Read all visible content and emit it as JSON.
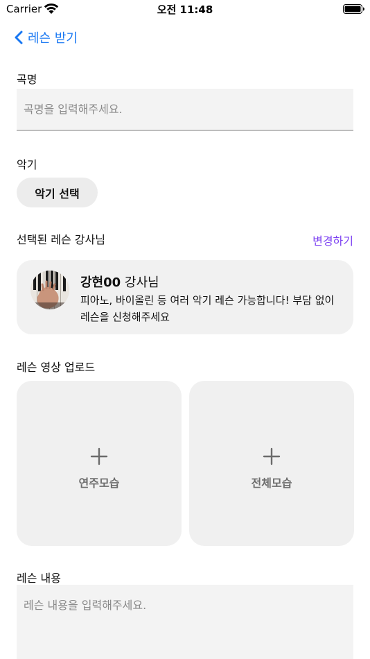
{
  "status_bar": {
    "carrier": "Carrier",
    "time": "오전 11:48"
  },
  "nav": {
    "back_label": "레슨 받기"
  },
  "song": {
    "label": "곡명",
    "placeholder": "곡명을 입력해주세요.",
    "value": ""
  },
  "instrument": {
    "label": "악기",
    "button_label": "악기 선택"
  },
  "teacher": {
    "section_label": "선택된 레슨 강사님",
    "change_label": "변경하기",
    "name": "강현00",
    "title_suffix": " 강사님",
    "description": "피아노, 바이올린 등 여러 악기 레슨 가능합니다! 부담 없이 레슨을 신청해주세요"
  },
  "upload": {
    "label": "레슨 영상 업로드",
    "tiles": [
      {
        "label": "연주모습"
      },
      {
        "label": "전체모습"
      }
    ]
  },
  "content": {
    "label": "레슨 내용",
    "placeholder": "레슨 내용을 입력해주세요.",
    "value": ""
  },
  "colors": {
    "accent_blue": "#1877f2",
    "accent_purple": "#7b3ff2",
    "field_bg": "#f3f3f3",
    "card_bg": "#f1f1f1"
  }
}
